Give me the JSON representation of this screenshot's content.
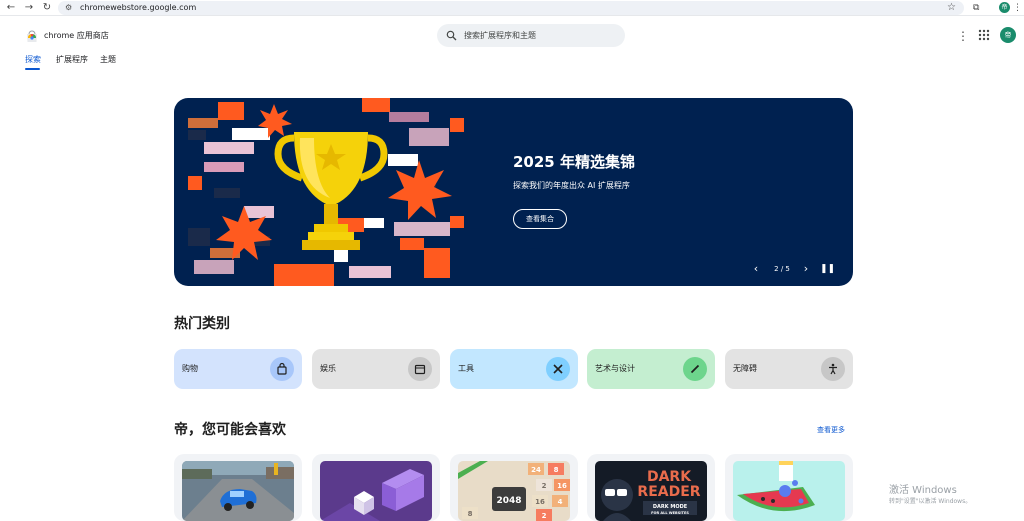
{
  "browser": {
    "url": "chromewebstore.google.com",
    "profile_initial": "帝"
  },
  "header": {
    "brand": "chrome 应用商店",
    "search_placeholder": "搜索扩展程序和主题",
    "avatar_initial": "帝"
  },
  "tabs": [
    {
      "label": "探索",
      "active": true
    },
    {
      "label": "扩展程序",
      "active": false
    },
    {
      "label": "主题",
      "active": false
    }
  ],
  "hero": {
    "title": "2025 年精选集锦",
    "subtitle": "探索我们的年度出众 AI 扩展程序",
    "button": "查看集合",
    "counter": "2 / 5",
    "background": "#002150"
  },
  "categories_section": {
    "title": "热门类别",
    "items": [
      {
        "label": "购物",
        "icon": "shopping-bag-icon",
        "bg": "#d3e3fd",
        "icon_bg": "#a8c7fa"
      },
      {
        "label": "娱乐",
        "icon": "calendar-icon",
        "bg": "#e3e3e3",
        "icon_bg": "#c7c7c7"
      },
      {
        "label": "工具",
        "icon": "tools-icon",
        "bg": "#c2e7ff",
        "icon_bg": "#7fcfff"
      },
      {
        "label": "艺术与设计",
        "icon": "pencil-icon",
        "bg": "#c4eed0",
        "icon_bg": "#6dd58c"
      },
      {
        "label": "无障碍",
        "icon": "accessibility-icon",
        "bg": "#e3e3e3",
        "icon_bg": "#c7c7c7"
      }
    ]
  },
  "recommend_section": {
    "title": "帝，您可能会喜欢",
    "see_more": "查看更多",
    "cards": [
      {
        "name": "car-racing-thumbnail"
      },
      {
        "name": "purple-blocks-thumbnail"
      },
      {
        "name": "game-2048-thumbnail",
        "text": "2048"
      },
      {
        "name": "dark-reader-thumbnail",
        "text_line1": "DARK",
        "text_line2": "READER",
        "text_line3": "DARK MODE",
        "text_line4": "FOR ALL WEBSITES"
      },
      {
        "name": "watermelon-thumbnail"
      }
    ]
  },
  "watermark": {
    "line1": "激活 Windows",
    "line2": "转到\"设置\"以激活 Windows。"
  }
}
